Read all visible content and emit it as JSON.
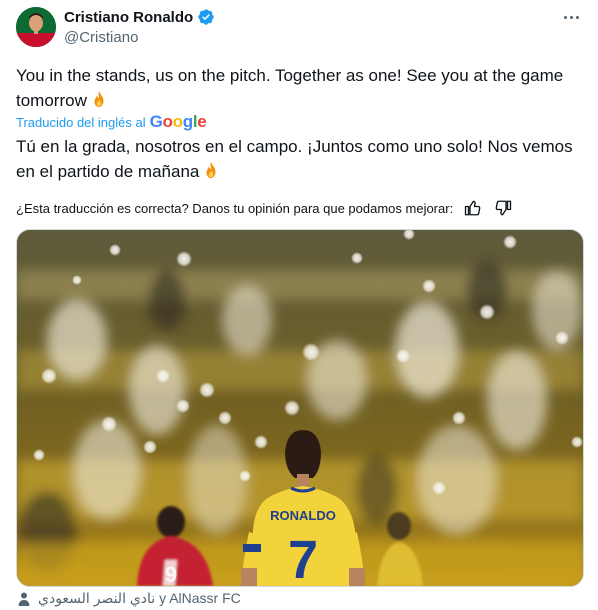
{
  "author": {
    "display_name": "Cristiano Ronaldo",
    "handle": "@Cristiano",
    "verified": true
  },
  "tweet": {
    "text": "You in the stands, us on the pitch. Together as one! See you at the game tomorrow",
    "emoji": "fire"
  },
  "translation": {
    "label": "Traducido del inglés al",
    "provider": "Google",
    "text": "Tú en la grada, nosotros en el campo. ¡Juntos como uno solo! Nos vemos en el partido de mañana",
    "feedback_prompt": "¿Esta traducción es correcta? Danos tu opinión para que podamos mejorar:"
  },
  "media": {
    "jersey_name": "RONALDO",
    "jersey_number": "7",
    "other_number": "9"
  },
  "tags": {
    "text": "نادي النصر السعودي y AlNassr FC"
  },
  "colors": {
    "accent": "#1d9bf0",
    "secondary_text": "#536471",
    "jersey_yellow": "#f6d43a",
    "jersey_blue": "#1f3f8f",
    "fire_orange": "#f4900c"
  }
}
